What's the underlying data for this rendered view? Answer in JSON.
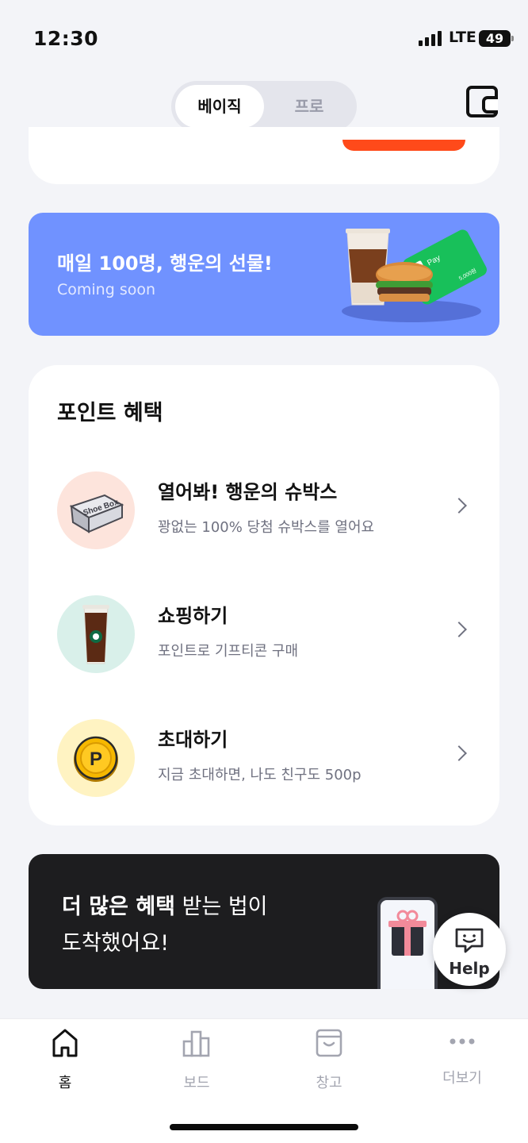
{
  "status_bar": {
    "time": "12:30",
    "network": "LTE",
    "battery": "49"
  },
  "header": {
    "tabs": [
      "베이직",
      "프로"
    ],
    "active_tab": "베이직",
    "wallet_icon": "wallet-icon"
  },
  "promo_banner": {
    "title": "매일 100명, 행운의 선물!",
    "subtitle": "Coming soon",
    "card_label": "Pay",
    "card_amount": "5,000원",
    "background_color": "#7092ff"
  },
  "points": {
    "title": "포인트 혜택",
    "items": [
      {
        "title": "열어봐! 행운의 슈박스",
        "description": "꽝없는 100% 당첨 슈박스를 열어요",
        "icon": "shoebox-icon",
        "icon_bg": "#fde4dc",
        "box_text": "Shoe Box"
      },
      {
        "title": "쇼핑하기",
        "description": "포인트로 기프티콘 구매",
        "icon": "iced-coffee-icon",
        "icon_bg": "#d9f0ea"
      },
      {
        "title": "초대하기",
        "description": "지금 초대하면, 나도 친구도 500p",
        "icon": "point-coin-icon",
        "icon_bg": "#fff3c2",
        "coin_letter": "P"
      }
    ]
  },
  "dark_banner": {
    "line1_bold": "더 많은 혜택",
    "line1_rest": " 받는 법이",
    "line2": "도착했어요!"
  },
  "help": {
    "label": "Help"
  },
  "bottom_nav": {
    "items": [
      {
        "label": "홈",
        "icon": "home-icon",
        "active": true
      },
      {
        "label": "보드",
        "icon": "chart-icon",
        "active": false
      },
      {
        "label": "창고",
        "icon": "storage-box-icon",
        "active": false
      },
      {
        "label": "더보기",
        "icon": "more-icon",
        "active": false
      }
    ]
  }
}
